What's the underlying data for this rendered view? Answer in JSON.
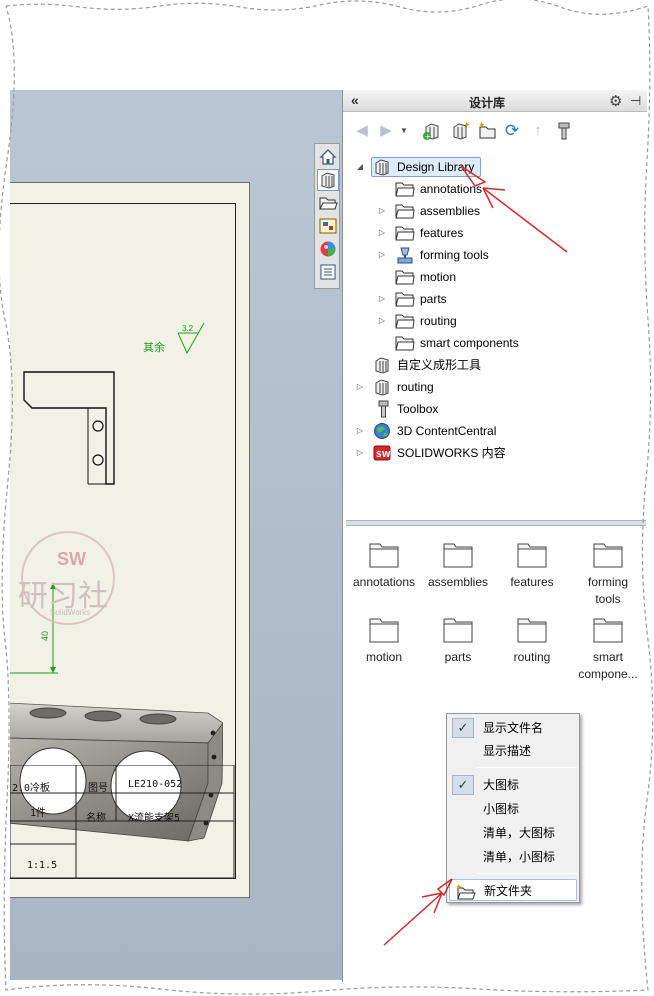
{
  "panel": {
    "title": "设计库",
    "collapse_glyph": "«",
    "toolbar_icons": [
      "back-icon",
      "forward-icon",
      "dropdown-icon",
      "add-file-location-icon",
      "add-library-icon",
      "new-folder-icon",
      "refresh-icon",
      "up-icon",
      "toolbox-icon"
    ]
  },
  "tree": {
    "items": [
      {
        "label": "Design Library",
        "icon": "library-icon",
        "expander": "expanded",
        "selected": true
      },
      {
        "label": "annotations",
        "icon": "folder-icon",
        "expander": "none"
      },
      {
        "label": "assemblies",
        "icon": "folder-icon",
        "expander": "collapsed"
      },
      {
        "label": "features",
        "icon": "folder-icon",
        "expander": "collapsed"
      },
      {
        "label": "forming tools",
        "icon": "forming-tools-icon",
        "expander": "collapsed"
      },
      {
        "label": "motion",
        "icon": "folder-icon",
        "expander": "none"
      },
      {
        "label": "parts",
        "icon": "folder-icon",
        "expander": "collapsed"
      },
      {
        "label": "routing",
        "icon": "folder-icon",
        "expander": "collapsed"
      },
      {
        "label": "smart components",
        "icon": "folder-icon",
        "expander": "none"
      },
      {
        "label": "自定义成形工具",
        "icon": "library-icon",
        "expander": "none"
      },
      {
        "label": "routing",
        "icon": "library-icon",
        "expander": "collapsed"
      },
      {
        "label": "Toolbox",
        "icon": "toolbox-icon",
        "expander": "none"
      },
      {
        "label": "3D ContentCentral",
        "icon": "globe-icon",
        "expander": "collapsed"
      },
      {
        "label": "SOLIDWORKS 内容",
        "icon": "sw-content-icon",
        "expander": "collapsed"
      }
    ]
  },
  "content": {
    "items": [
      {
        "line1": "annotations",
        "line2": ""
      },
      {
        "line1": "assemblies",
        "line2": ""
      },
      {
        "line1": "features",
        "line2": ""
      },
      {
        "line1": "forming",
        "line2": "tools"
      },
      {
        "line1": "motion",
        "line2": ""
      },
      {
        "line1": "parts",
        "line2": ""
      },
      {
        "line1": "routing",
        "line2": ""
      },
      {
        "line1": "smart",
        "line2": "compone..."
      }
    ]
  },
  "context_menu": {
    "show_filename": "显示文件名",
    "show_description": "显示描述",
    "large_icons": "大图标",
    "small_icons": "小图标",
    "list_large": "清单，大图标",
    "list_small": "清单，小图标",
    "new_folder": "新文件夹",
    "checked": [
      "显示文件名",
      "大图标"
    ]
  },
  "drawing": {
    "roughness_label": "其余",
    "roughness_value": "3.2",
    "dimension": "40",
    "watermark_top": "SW",
    "watermark_main": "研习社",
    "watermark_sub": "SolidWorks",
    "title_block": {
      "material": "2.0冷板",
      "qty": "1件",
      "scale": "1:1.5",
      "drawing_no_label": "图号",
      "drawing_no": "LE210-052",
      "name_label": "名称",
      "name": "X流能支架5"
    }
  },
  "colors": {
    "annotation_arrow": "#d42a2a",
    "selection_fill": "#dcecfc",
    "selection_border": "#7da2ce",
    "dimension_green": "#1aa31a",
    "sheet_bg": "#f1f1e6"
  }
}
